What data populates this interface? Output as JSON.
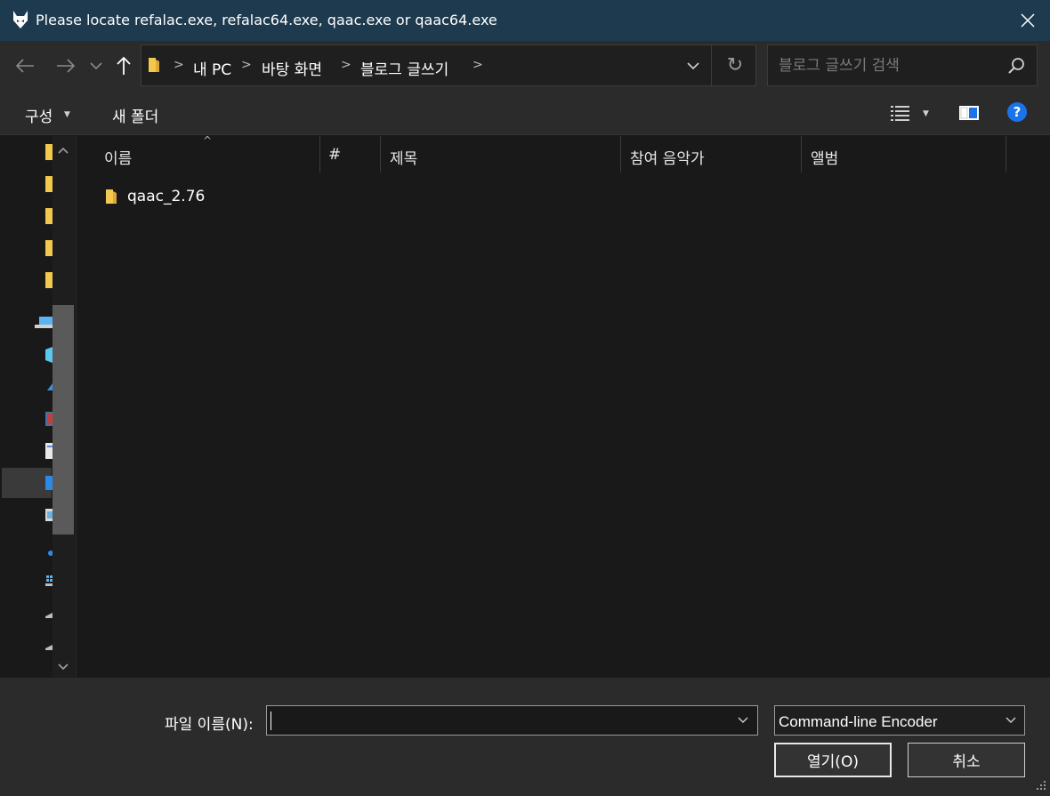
{
  "window": {
    "title": "Please locate refalac.exe, refalac64.exe, qaac.exe or qaac64.exe"
  },
  "nav": {
    "back": "←",
    "forward": "→",
    "recent": "⌄",
    "up": "↑",
    "breadcrumbs": [
      "내 PC",
      "바탕 화면",
      "블로그 글쓰기"
    ],
    "refresh": "↻"
  },
  "search": {
    "placeholder": "블로그 글쓰기 검색"
  },
  "toolbar": {
    "organize_label": "구성",
    "new_folder_label": "새 폴더"
  },
  "columns": {
    "name": "이름",
    "number": "#",
    "title": "제목",
    "artist": "참여 음악가",
    "album": "앨범"
  },
  "files": [
    {
      "name": "qaac_2.76",
      "type": "folder"
    }
  ],
  "footer": {
    "filename_label": "파일 이름(N):",
    "filename_value": "",
    "filetype_value": "Command-line Encoder",
    "open_label": "열기(O)",
    "cancel_label": "취소"
  },
  "colors": {
    "titlebar": "#1e3a4e",
    "background": "#191919",
    "panel": "#2b2b2b",
    "folder": "#f2c94c",
    "help": "#1a73e8"
  },
  "icons": {
    "app": "fox-icon",
    "close": "close-icon",
    "folder": "folder-icon",
    "search": "search-icon",
    "view": "view-details-icon",
    "preview": "preview-pane-icon",
    "help": "help-icon"
  }
}
